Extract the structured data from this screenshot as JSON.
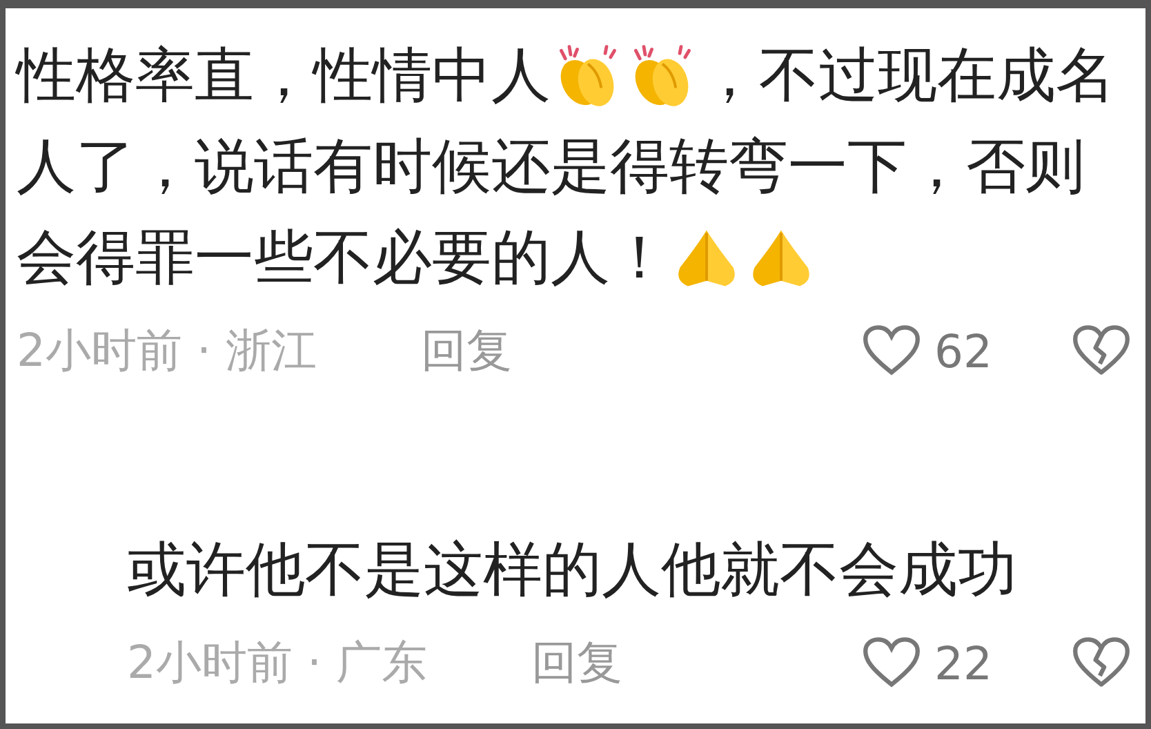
{
  "comments": [
    {
      "lines": [
        [
          {
            "kind": "text",
            "text": "性格率直，性情中人"
          },
          {
            "kind": "clap"
          },
          {
            "kind": "clap"
          },
          {
            "kind": "text",
            "text": "，不过现在成名"
          }
        ],
        [
          {
            "kind": "text",
            "text": "人了，说话有时候还是得转弯一下，否则"
          }
        ],
        [
          {
            "kind": "text",
            "text": "会得罪一些不必要的人！"
          },
          {
            "kind": "pray"
          },
          {
            "kind": "pray"
          }
        ]
      ],
      "time": "2小时前 · 浙江",
      "reply": "回复",
      "likes": "62"
    },
    {
      "lines": [
        [
          {
            "kind": "text",
            "text": "或许他不是这样的人他就不会成功"
          }
        ]
      ],
      "time": "2小时前 · 广东",
      "reply": "回复",
      "likes": "22"
    }
  ]
}
